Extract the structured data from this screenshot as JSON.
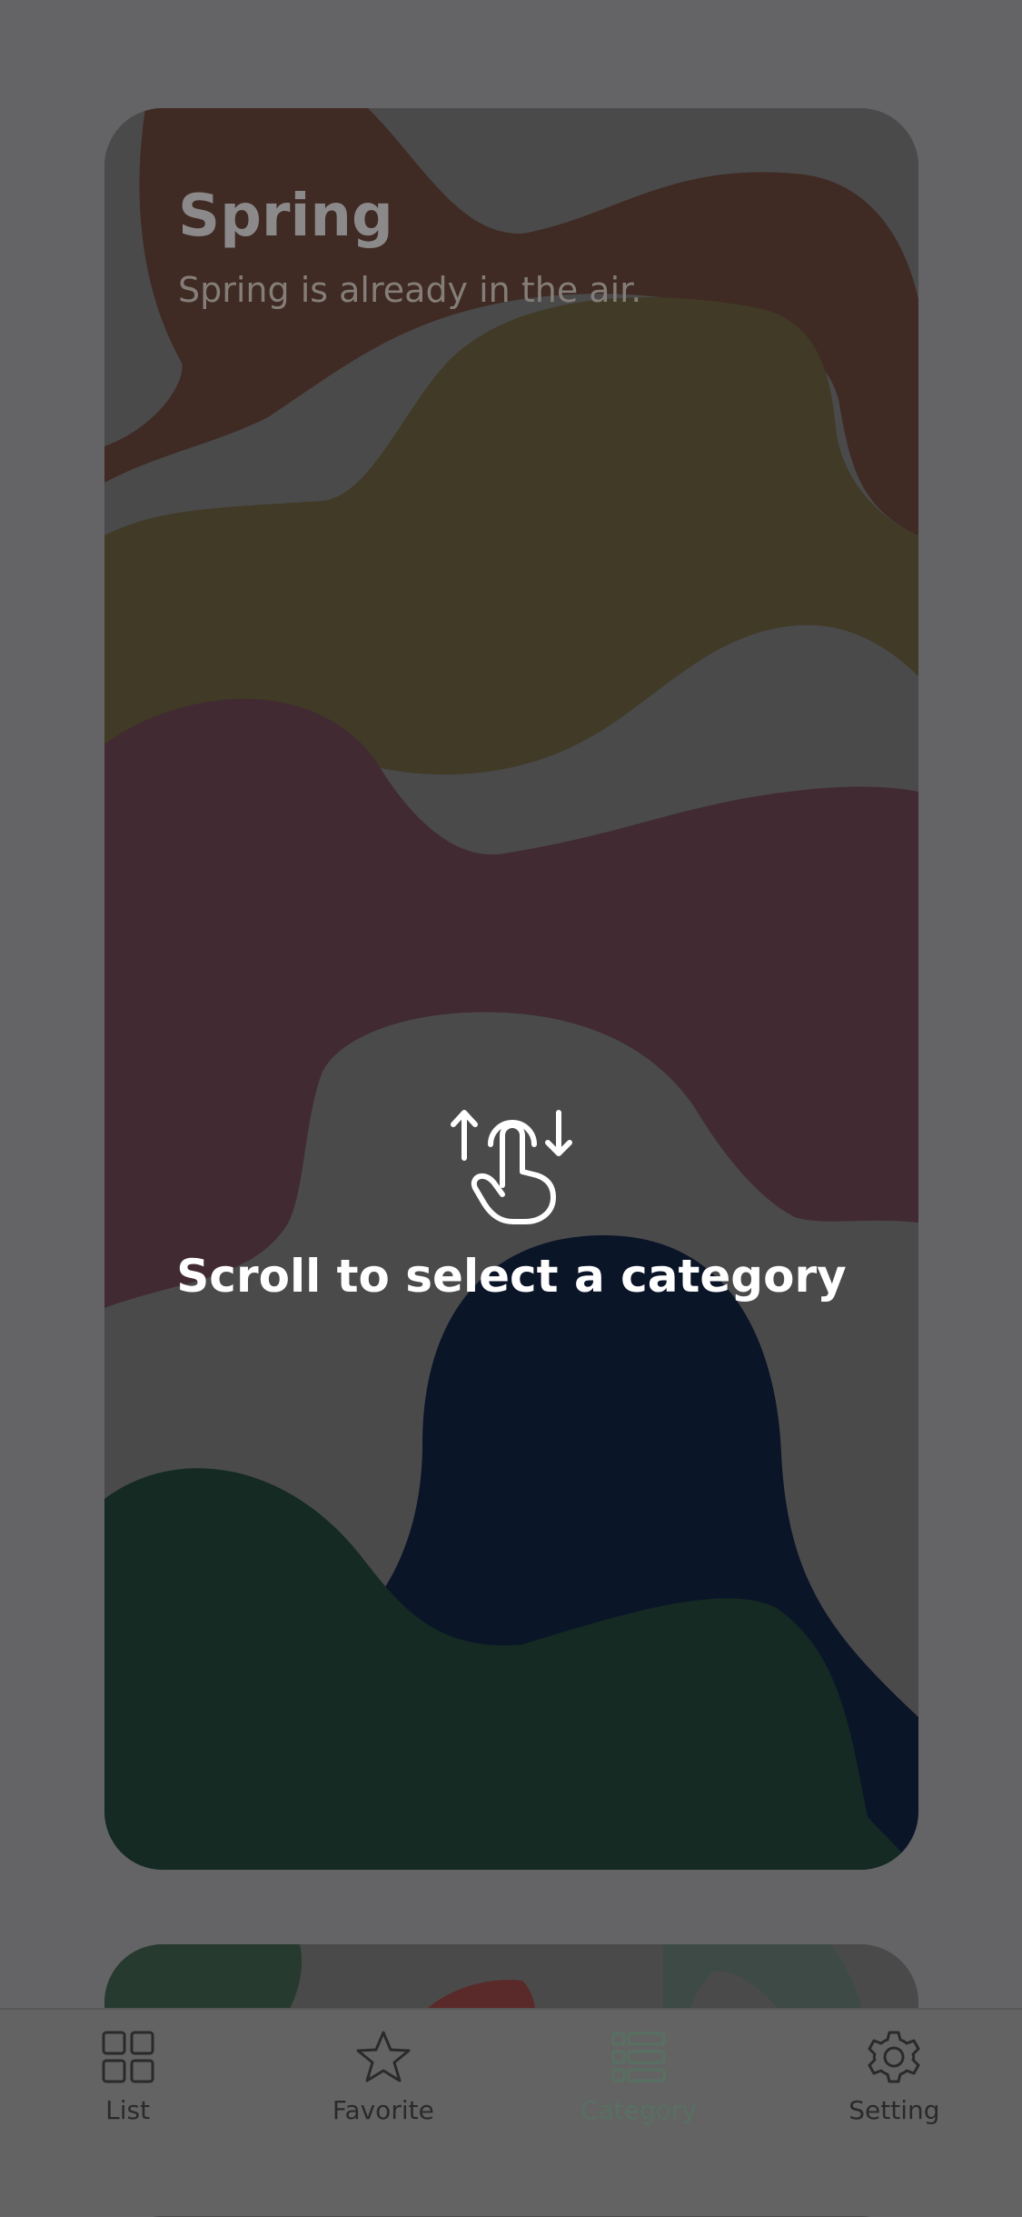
{
  "card": {
    "title": "Spring",
    "subtitle": "Spring is already in the air."
  },
  "hint": {
    "text": "Scroll to select a category",
    "icon": "swipe-up-down-icon"
  },
  "tabs": [
    {
      "label": "List",
      "icon": "grid-icon",
      "active": false
    },
    {
      "label": "Favorite",
      "icon": "star-icon",
      "active": false
    },
    {
      "label": "Category",
      "icon": "category-list-icon",
      "active": true
    },
    {
      "label": "Setting",
      "icon": "gear-icon",
      "active": false
    }
  ],
  "colors": {
    "overlay": "#646466",
    "active_tab": "#577061",
    "blob_brown": "#3f2a24",
    "blob_olive": "#403a26",
    "blob_plum": "#412a32",
    "blob_navy": "#0b1528",
    "blob_green": "#142a23"
  }
}
